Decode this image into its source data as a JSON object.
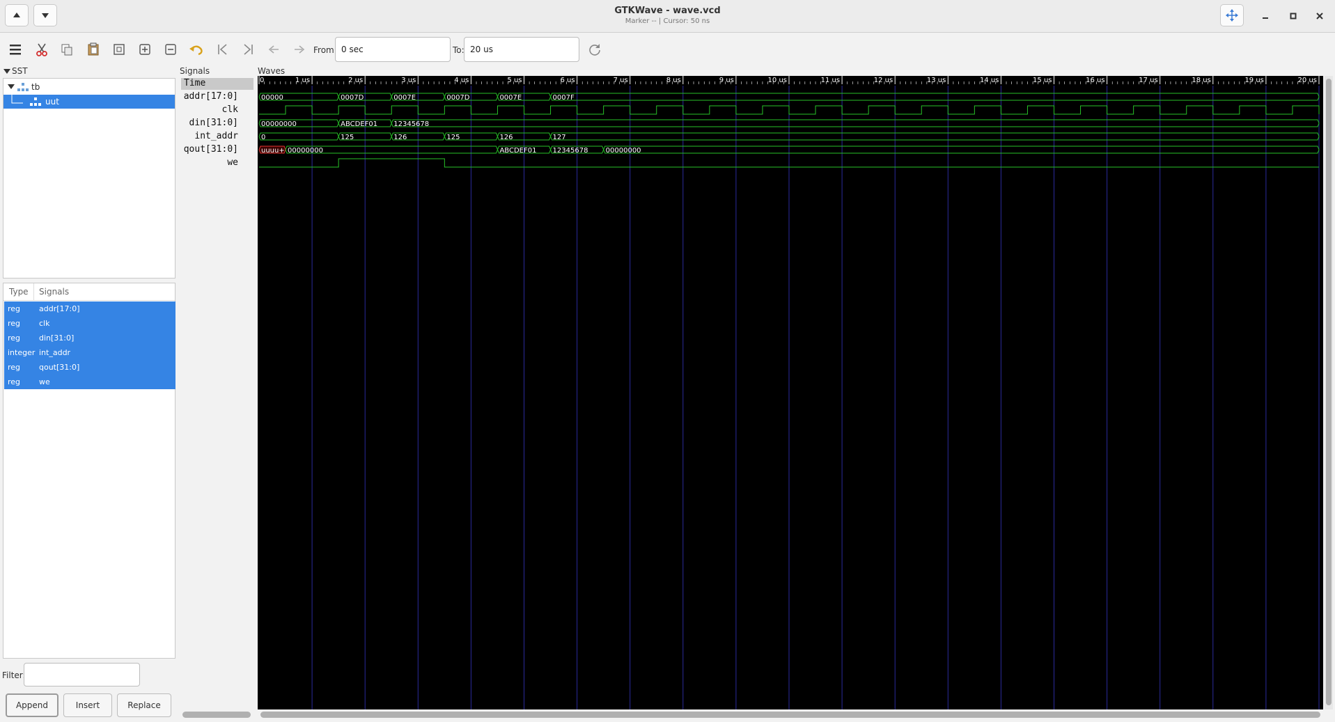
{
  "window": {
    "title": "GTKWave - wave.vcd",
    "subtitle": "Marker --  |  Cursor: 50 ns"
  },
  "toolbar": {
    "from_label": "From:",
    "from_value": "0 sec",
    "to_label": "To:",
    "to_value": "20 us"
  },
  "sst": {
    "label": "SST",
    "tree": [
      {
        "name": "tb",
        "icon": "hierarchy-icon"
      },
      {
        "name": "uut",
        "icon": "hierarchy-icon"
      }
    ]
  },
  "signal_list": {
    "headers": [
      "Type",
      "Signals"
    ],
    "rows": [
      {
        "type": "reg",
        "name": "addr[17:0]"
      },
      {
        "type": "reg",
        "name": "clk"
      },
      {
        "type": "reg",
        "name": "din[31:0]"
      },
      {
        "type": "integer",
        "name": "int_addr"
      },
      {
        "type": "reg",
        "name": "qout[31:0]"
      },
      {
        "type": "reg",
        "name": "we"
      }
    ]
  },
  "filter": {
    "label": "Filter:",
    "value": ""
  },
  "buttons": {
    "append": "Append",
    "insert": "Insert",
    "replace": "Replace"
  },
  "signals_panel": {
    "label": "Signals",
    "time_label": "Time",
    "names": [
      "addr[17:0]",
      "clk",
      "din[31:0]",
      "int_addr",
      "qout[31:0]",
      "we"
    ]
  },
  "waves_panel": {
    "label": "Waves",
    "ruler": [
      "0",
      "1 us",
      "2 us",
      "3 us",
      "4 us",
      "5 us",
      "6 us",
      "7 us",
      "8 us",
      "9 us",
      "10 us",
      "11 us",
      "12 us",
      "13 us",
      "14 us",
      "15 us",
      "16 us",
      "17 us",
      "18 us",
      "19 us",
      "20 us"
    ],
    "time_range_us": [
      0,
      20
    ],
    "trace_color": "#27c227",
    "grid_color": "#2a2a9c",
    "buses": [
      {
        "name": "addr",
        "segments": [
          {
            "start": 0,
            "end": 1.5,
            "label": "00000"
          },
          {
            "start": 1.5,
            "end": 2.5,
            "label": "0007D"
          },
          {
            "start": 2.5,
            "end": 3.5,
            "label": "0007E"
          },
          {
            "start": 3.5,
            "end": 4.5,
            "label": "0007D"
          },
          {
            "start": 4.5,
            "end": 5.5,
            "label": "0007E"
          },
          {
            "start": 5.5,
            "end": 20,
            "label": "0007F"
          }
        ]
      },
      {
        "name": "din",
        "segments": [
          {
            "start": 0,
            "end": 1.5,
            "label": "00000000"
          },
          {
            "start": 1.5,
            "end": 2.5,
            "label": "ABCDEF01"
          },
          {
            "start": 2.5,
            "end": 20,
            "label": "12345678"
          }
        ]
      },
      {
        "name": "int_addr",
        "segments": [
          {
            "start": 0,
            "end": 1.5,
            "label": "0"
          },
          {
            "start": 1.5,
            "end": 2.5,
            "label": "125"
          },
          {
            "start": 2.5,
            "end": 3.5,
            "label": "126"
          },
          {
            "start": 3.5,
            "end": 4.5,
            "label": "125"
          },
          {
            "start": 4.5,
            "end": 5.5,
            "label": "126"
          },
          {
            "start": 5.5,
            "end": 20,
            "label": "127"
          }
        ]
      },
      {
        "name": "qout",
        "segments": [
          {
            "start": 0,
            "end": 0.5,
            "label": "uuuu+",
            "undefined": true
          },
          {
            "start": 0.5,
            "end": 4.5,
            "label": "00000000"
          },
          {
            "start": 4.5,
            "end": 5.5,
            "label": "ABCDEF01"
          },
          {
            "start": 5.5,
            "end": 6.5,
            "label": "12345678"
          },
          {
            "start": 6.5,
            "end": 20,
            "label": "00000000"
          }
        ]
      }
    ],
    "clk": {
      "start_high": 0.5,
      "period_us": 1,
      "duty": 0.5
    },
    "we": {
      "high_from": 1.5,
      "high_to": 3.5
    }
  }
}
